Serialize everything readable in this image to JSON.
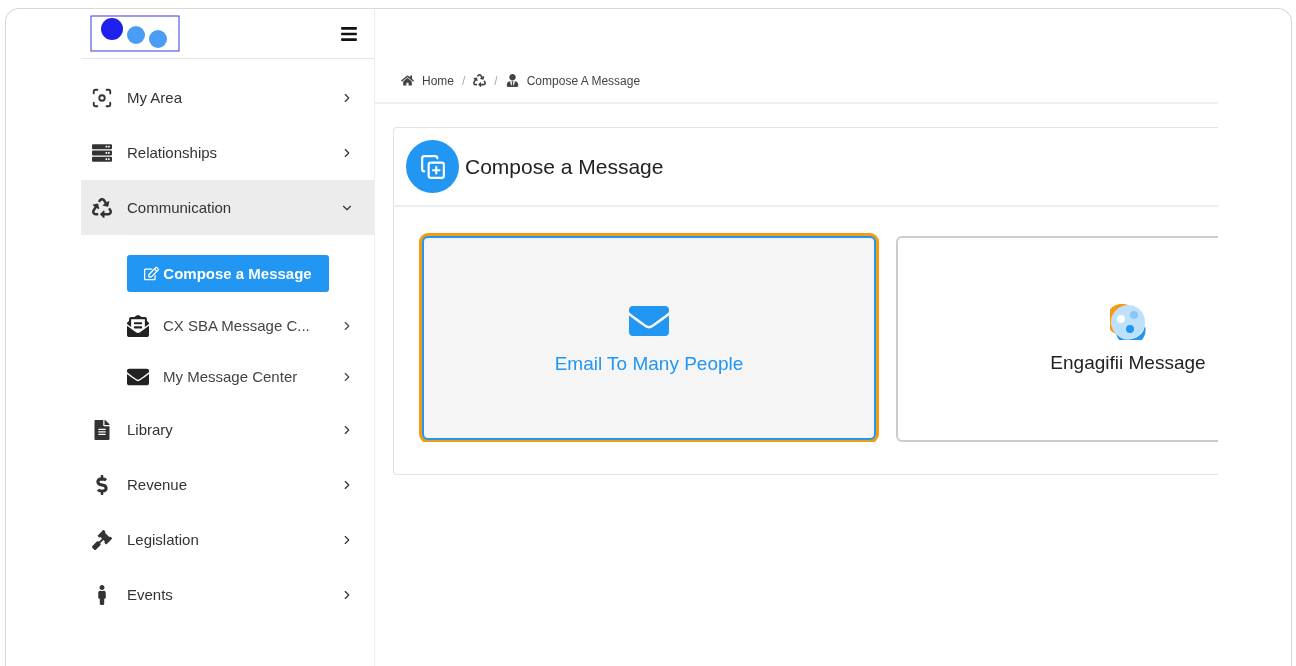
{
  "sidebar": {
    "items": [
      {
        "kind": "item",
        "label": "My Area",
        "expanded": false,
        "selected": false
      },
      {
        "kind": "item",
        "label": "Relationships",
        "expanded": false,
        "selected": false
      },
      {
        "kind": "item",
        "label": "Communication",
        "expanded": true,
        "selected": true,
        "children": [
          {
            "kind": "button",
            "label": "Compose a Message"
          },
          {
            "kind": "subitem",
            "label": "CX SBA Message C..."
          },
          {
            "kind": "subitem",
            "label": "My Message Center"
          }
        ]
      },
      {
        "kind": "item",
        "label": "Library",
        "expanded": false,
        "selected": false
      },
      {
        "kind": "item",
        "label": "Revenue",
        "expanded": false,
        "selected": false
      },
      {
        "kind": "item",
        "label": "Legislation",
        "expanded": false,
        "selected": false
      },
      {
        "kind": "item",
        "label": "Events",
        "expanded": false,
        "selected": false
      }
    ]
  },
  "breadcrumb": [
    {
      "kind": "icon"
    },
    {
      "kind": "link",
      "label": "Home"
    },
    {
      "kind": "separator",
      "label": "/"
    },
    {
      "kind": "icon"
    },
    {
      "kind": "separator",
      "label": "/"
    },
    {
      "kind": "icon"
    },
    {
      "kind": "link",
      "label": "Compose A Message"
    }
  ],
  "panel": {
    "title": "Compose a Message",
    "options": [
      {
        "label": "Email To Many People",
        "selected": true
      },
      {
        "label": "Engagifii Message",
        "selected": false
      }
    ]
  }
}
